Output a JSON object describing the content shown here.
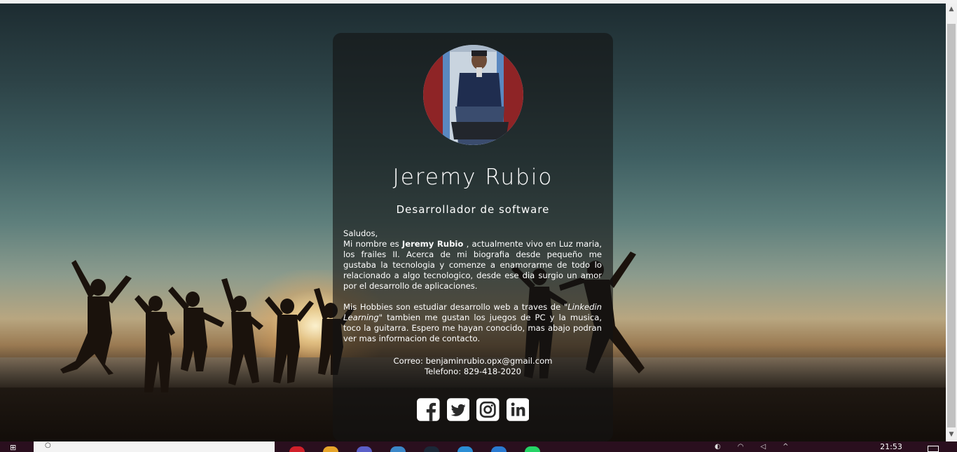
{
  "profile": {
    "name": "Jeremy Rubio",
    "role": "Desarrollador de software",
    "greeting": "Saludos,",
    "bio_intro": "Mi nombre es",
    "bio_name": "Jeremy Rubio",
    "bio_rest": ", actualmente vivo en Luz maria, los frailes II. Acerca de mi biografia desde pequeño me gustaba la tecnologia y comenze a enamorarme de todo lo relacionado a algo tecnologico, desde ese dia surgio un amor por el desarrollo de aplicaciones.",
    "hobbies_intro": "Mis Hobbies son estudiar desarrollo web a traves de",
    "hobbies_course": "\"Linkedin Learning\"",
    "hobbies_rest": "tambien me gustan los juegos de PC y la musica, toco la guitarra. Espero me hayan conocido, mas abajo podran ver mas informacion de contacto.",
    "email_line": "Correo: benjaminrubio.opx@gmail.com",
    "phone_line": "Telefono: 829-418-2020"
  },
  "social": [
    {
      "name": "facebook",
      "icon": "facebook-icon"
    },
    {
      "name": "twitter",
      "icon": "twitter-icon"
    },
    {
      "name": "instagram",
      "icon": "instagram-icon"
    },
    {
      "name": "linkedin",
      "icon": "linkedin-icon"
    }
  ],
  "taskbar": {
    "clock": "21:53",
    "apps": [
      {
        "name": "opera",
        "color": "#d0202a"
      },
      {
        "name": "file-explorer",
        "color": "#e7a52a"
      },
      {
        "name": "teams",
        "color": "#5b5fc7"
      },
      {
        "name": "calculator",
        "color": "#3b87c8"
      },
      {
        "name": "steam",
        "color": "#1b2838"
      },
      {
        "name": "edge",
        "color": "#2b8dd4"
      },
      {
        "name": "vscode",
        "color": "#2a7ad1"
      },
      {
        "name": "whatsapp",
        "color": "#25d366"
      }
    ]
  },
  "colors": {
    "card_bg": "rgba(20,20,20,0.62)",
    "text": "#ffffff",
    "taskbar": "#2a0f1e"
  }
}
